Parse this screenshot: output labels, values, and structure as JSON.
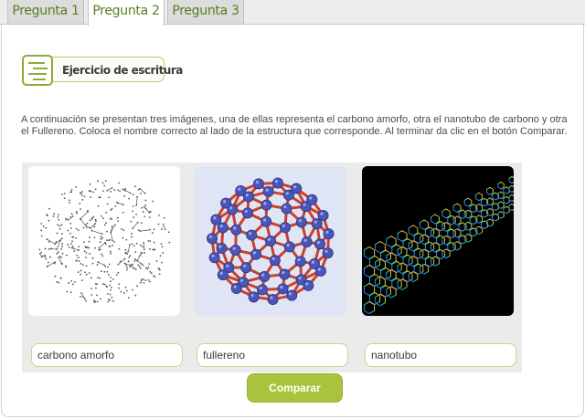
{
  "tabs": [
    {
      "label": "Pregunta 1",
      "active": false
    },
    {
      "label": "Pregunta 2",
      "active": true
    },
    {
      "label": "Pregunta 3",
      "active": false
    }
  ],
  "exercise": {
    "title": "Ejercicio de escritura",
    "icon": "writing-exercise-icon"
  },
  "instructions": "A continuación se presentan tres imágenes, una de ellas representa el carbono amorfo, otra el nanotubo de carbono y otra el Fullereno. Coloca el nombre correcto al lado de la estructura que corresponde. Al terminar da clic en el botón Comparar.",
  "images": [
    {
      "name": "amorphous-carbon-image"
    },
    {
      "name": "fullerene-image"
    },
    {
      "name": "nanotube-image"
    }
  ],
  "answers": [
    "carbono amorfo",
    "fullereno",
    "nanotubo"
  ],
  "compare_button": "Comparar",
  "colors": {
    "accent": "#a8c43c",
    "tab_text": "#5a7d1c",
    "field_border": "#c5d98a"
  }
}
